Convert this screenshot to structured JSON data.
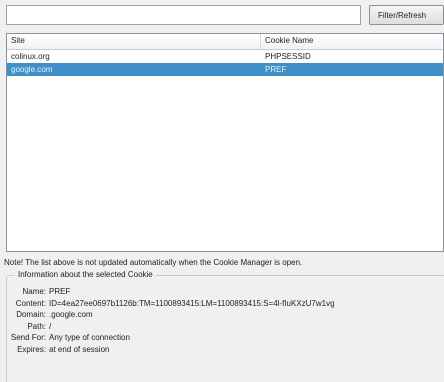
{
  "filter": {
    "value": "",
    "button_label": "Filter/Refresh"
  },
  "list": {
    "columns": [
      "Site",
      "Cookie Name"
    ],
    "rows": [
      {
        "site": "colinux.org",
        "name": "PHPSESSID",
        "selected": false
      },
      {
        "site": "google.com",
        "name": "PREF",
        "selected": true
      }
    ]
  },
  "note": "Note! The list above is not updated automatically when the Cookie Manager is open.",
  "info": {
    "title": "Information about the selected Cookie",
    "fields": [
      {
        "label": "Name:",
        "value": "PREF"
      },
      {
        "label": "Content:",
        "value": "ID=4ea27ee0697b1126b:TM=1100893415:LM=1100893415:S=4l-fIuKXzU7w1vg"
      },
      {
        "label": "Domain:",
        "value": ".google.com"
      },
      {
        "label": "Path:",
        "value": "/"
      },
      {
        "label": "Send For:",
        "value": "Any type of connection"
      },
      {
        "label": "Expires:",
        "value": "at end of session"
      }
    ]
  },
  "colors": {
    "selection": "#3f8fc9",
    "background": "#f0f0f0"
  }
}
